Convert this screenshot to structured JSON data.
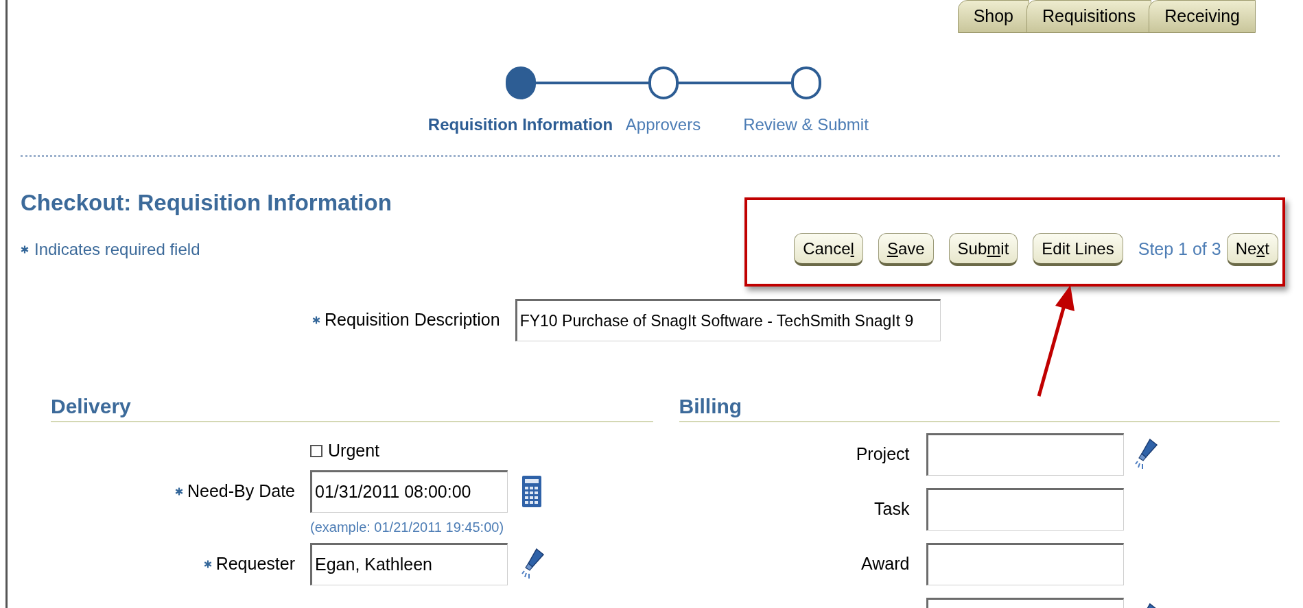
{
  "tabs": [
    {
      "label": "Shop"
    },
    {
      "label": "Requisitions"
    },
    {
      "label": "Receiving"
    }
  ],
  "train": [
    {
      "label": "Requisition Information",
      "selected": true
    },
    {
      "label": "Approvers",
      "selected": false
    },
    {
      "label": "Review & Submit",
      "selected": false
    }
  ],
  "heading": "Checkout: Requisition Information",
  "required_note": "Indicates required field",
  "toolbar": [
    {
      "kind": "button",
      "before": "Cance",
      "key": "l"
    },
    {
      "kind": "button",
      "key": "S",
      "after": "ave"
    },
    {
      "kind": "button",
      "before": "Sub",
      "key": "m",
      "after": "it"
    },
    {
      "kind": "button",
      "before": "Edit Lines"
    },
    {
      "kind": "text",
      "label": "Step 1 of 3"
    },
    {
      "kind": "button",
      "before": "Ne",
      "key": "x",
      "after": "t"
    }
  ],
  "requisition_description": {
    "label": "Requisition Description",
    "required": true,
    "value": "FY10 Purchase of SnagIt Software - TechSmith SnagIt 9"
  },
  "delivery": {
    "title": "Delivery",
    "urgent": {
      "label": "Urgent",
      "checked": false
    },
    "fields": [
      {
        "label": "Need-By Date",
        "required": true,
        "value": "01/31/2011 08:00:00",
        "hint": "(example: 01/21/2011 19:45:00)",
        "kind": "date"
      },
      {
        "label": "Requester",
        "required": true,
        "value": "Egan, Kathleen",
        "kind": "lookup"
      }
    ]
  },
  "billing": {
    "title": "Billing",
    "fields": [
      {
        "label": "Project",
        "kind": "lookup"
      },
      {
        "label": "Task",
        "kind": "text"
      },
      {
        "label": "Award",
        "kind": "text"
      },
      {
        "kind": "lookup"
      }
    ]
  }
}
